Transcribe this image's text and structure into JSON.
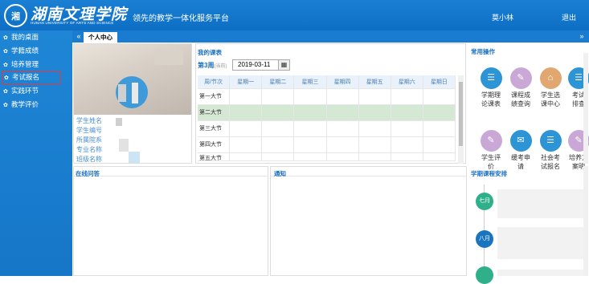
{
  "header": {
    "logo_text": "湖南文理学院",
    "logo_subtext": "HUNAN UNIVERSITY OF ARTS AND SCIENCE",
    "slogan": "领先的教学一体化服务平台",
    "user_name": "莫小林",
    "logout_label": "退出"
  },
  "sidebar": {
    "items": [
      {
        "label": "我的桌面"
      },
      {
        "label": "学籍成绩"
      },
      {
        "label": "培养管理"
      },
      {
        "label": "考试报名"
      },
      {
        "label": "实践环节"
      },
      {
        "label": "教学评价"
      }
    ]
  },
  "tabs": {
    "collapse_glyph": "«",
    "expand_glyph": "»",
    "active_tab": "个人中心"
  },
  "profile": {
    "fields": [
      "学生姓名",
      "学生编号",
      "所属院系",
      "专业名称",
      "班级名称"
    ]
  },
  "schedule": {
    "title": "我的课表",
    "week_label": "第3周",
    "week_hint": "(当前)",
    "date_value": "2019-03-11",
    "columns": [
      "周/节次",
      "星期一",
      "星期二",
      "星期三",
      "星期四",
      "星期五",
      "星期六",
      "星期日"
    ],
    "rows": [
      "第一大节",
      "第二大节",
      "第三大节",
      "第四大节",
      "第五大节"
    ]
  },
  "operations": {
    "title": "常用操作",
    "items": [
      {
        "line1": "学期理",
        "line2": "论课表",
        "icon": "document-icon",
        "color": "#2d94d6"
      },
      {
        "line1": "课程成",
        "line2": "绩查询",
        "icon": "pen-icon",
        "color": "#c9a8d6"
      },
      {
        "line1": "学生选",
        "line2": "课中心",
        "icon": "building-icon",
        "color": "#e0a870"
      },
      {
        "line1": "考试",
        "line2": "排查",
        "icon": "document-icon",
        "color": "#2d94d6"
      },
      {
        "line1": "学生评",
        "line2": "价",
        "icon": "pen-icon",
        "color": "#c9a8d6"
      },
      {
        "line1": "缓考申",
        "line2": "请",
        "icon": "mail-icon",
        "color": "#2d94d6"
      },
      {
        "line1": "社会考",
        "line2": "试报名",
        "icon": "document-icon",
        "color": "#2d94d6"
      },
      {
        "line1": "培养方",
        "line2": "案明",
        "icon": "pen-icon",
        "color": "#c9a8d6"
      }
    ]
  },
  "questions": {
    "title": "在线问答"
  },
  "notices": {
    "title": "通知"
  },
  "semester": {
    "title": "学期课程安排",
    "months": [
      {
        "label": "七月",
        "color": "#2fb08a"
      },
      {
        "label": "八月",
        "color": "#1a74c0"
      },
      {
        "label": "",
        "color": "#2fb08a"
      }
    ]
  }
}
